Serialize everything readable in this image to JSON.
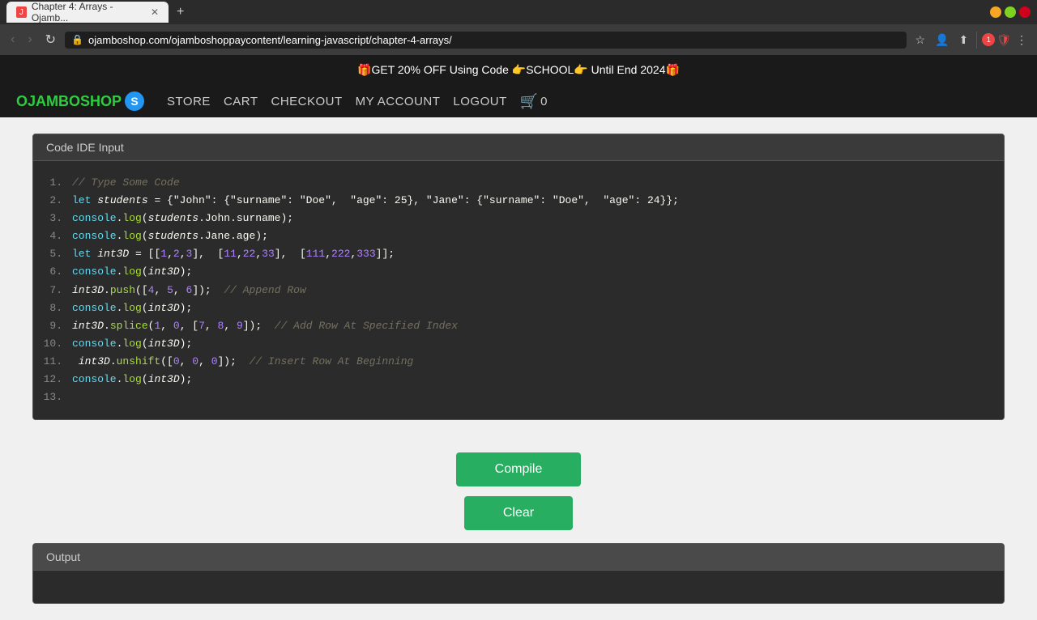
{
  "browser": {
    "tab_title": "Chapter 4: Arrays - Ojamb...",
    "url": "ojamboshop.com/ojamboshoppaycontent/learning-javascript/chapter-4-arrays/",
    "favicon": "J",
    "new_tab_icon": "+",
    "back_btn": "‹",
    "forward_btn": "›",
    "refresh_btn": "↻"
  },
  "promo": {
    "text": "🎁GET 20% OFF Using Code 👉SCHOOL👉 Until End 2024🎁"
  },
  "nav": {
    "logo": "OJAMBOSHOP",
    "logo_s": "S",
    "links": [
      "STORE",
      "CART",
      "CHECKOUT",
      "MY ACCOUNT",
      "LOGOUT"
    ],
    "cart_count": "0"
  },
  "ide": {
    "header": "Code IDE Input",
    "compile_btn": "Compile",
    "clear_btn": "Clear",
    "output_header": "Output"
  }
}
